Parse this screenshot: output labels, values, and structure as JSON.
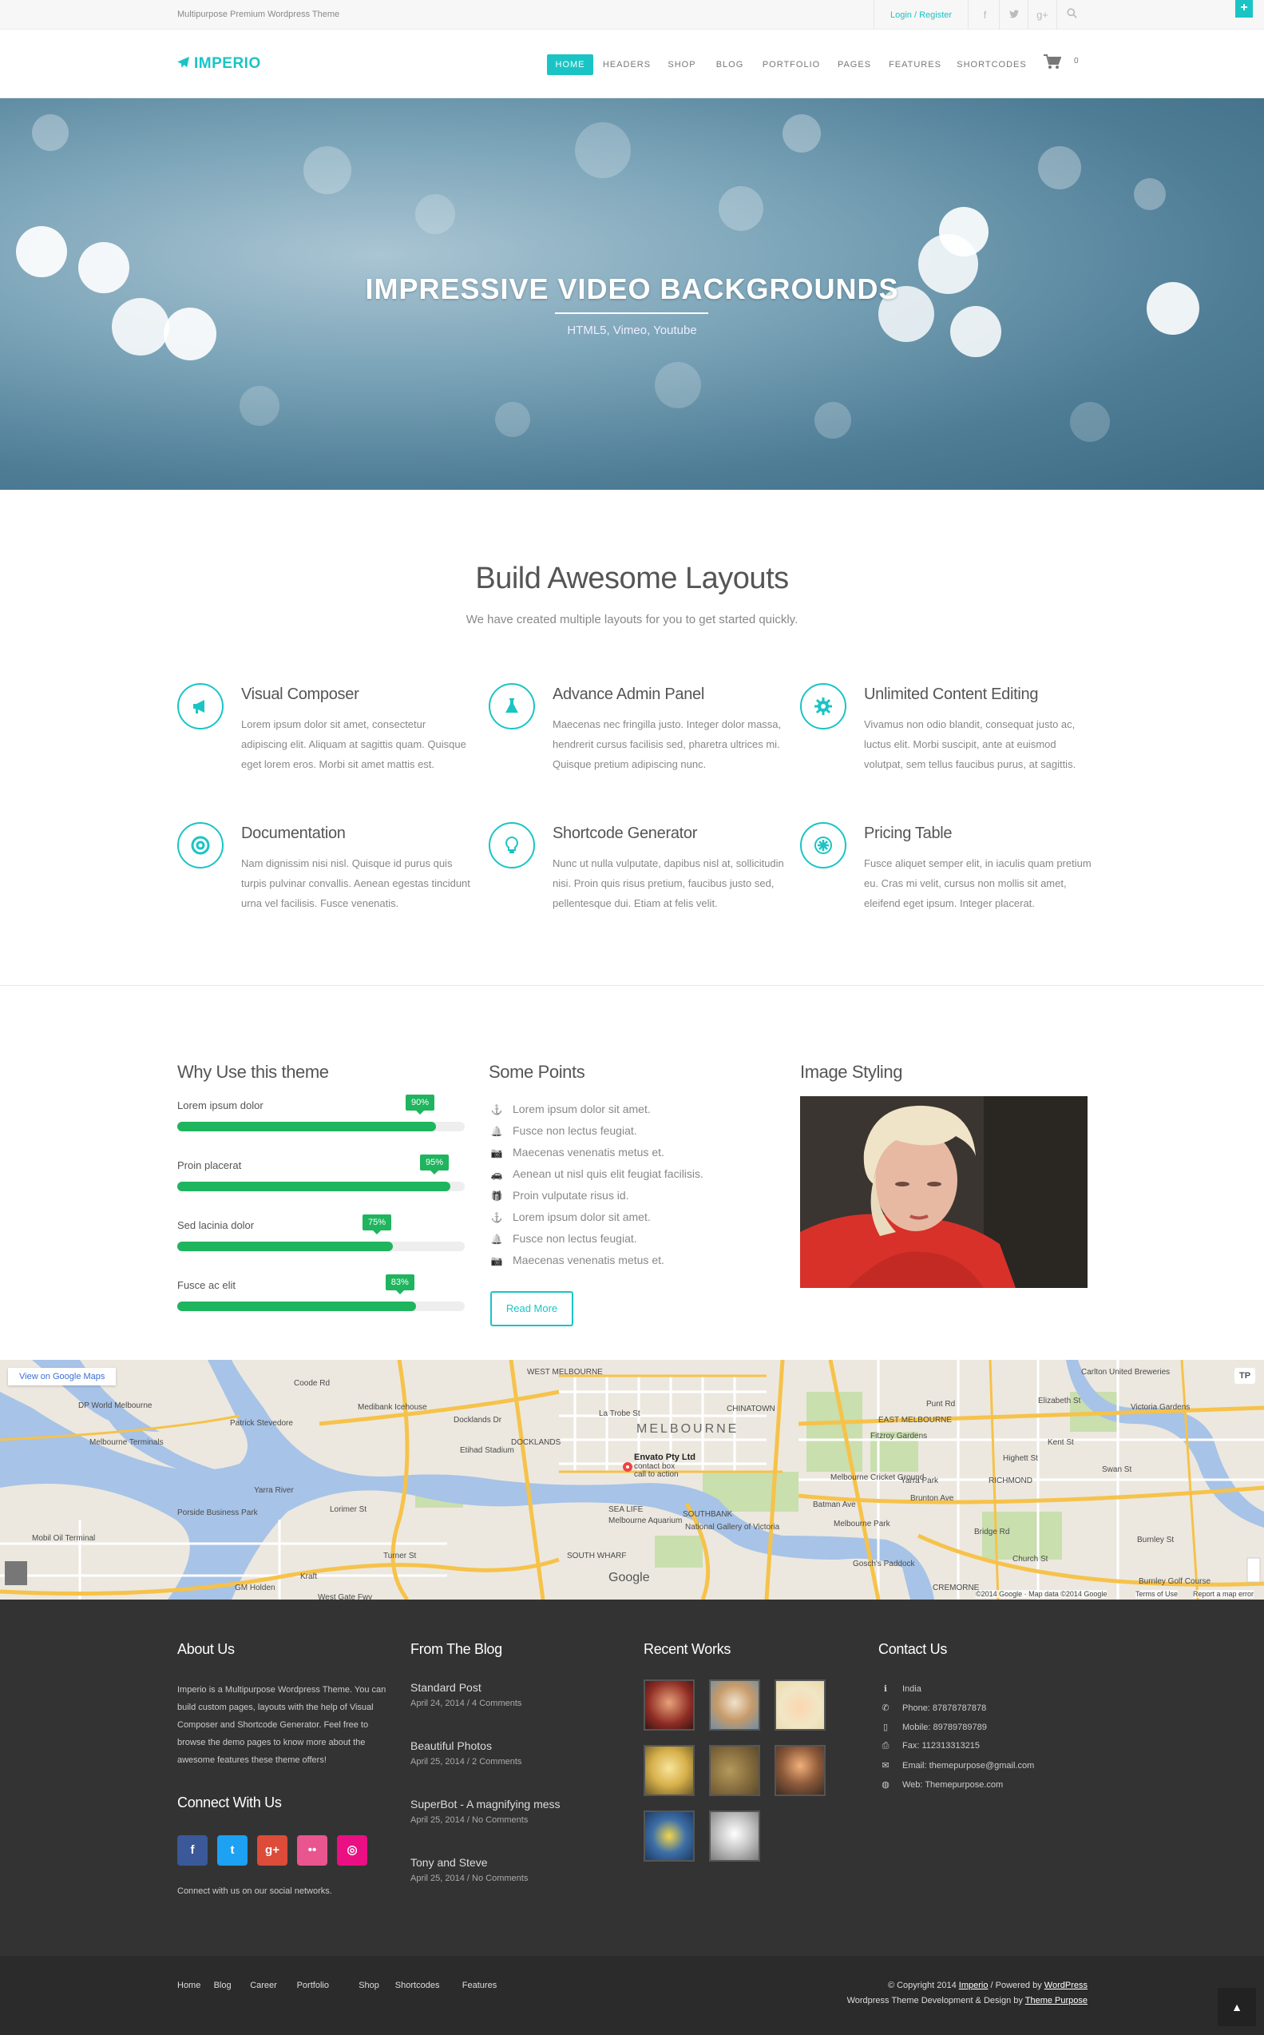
{
  "topbar": {
    "tagline": "Multipurpose Premium Wordpress Theme",
    "login_label": "Login / Register",
    "social_icons": [
      "facebook-icon",
      "twitter-icon",
      "googleplus-icon",
      "search-icon"
    ],
    "plus_label": "+"
  },
  "header": {
    "logo": "IMPERIO",
    "nav": [
      "HOME",
      "HEADERS",
      "SHOP",
      "BLOG",
      "PORTFOLIO",
      "PAGES",
      "FEATURES",
      "SHORTCODES"
    ],
    "active_nav": "HOME",
    "cart_count": "0"
  },
  "hero": {
    "title": "IMPRESSIVE VIDEO BACKGROUNDS",
    "subtitle": "HTML5, Vimeo, Youtube"
  },
  "features": {
    "title": "Build Awesome Layouts",
    "subtitle": "We have created multiple layouts for you to get started quickly.",
    "items": [
      {
        "title": "Visual Composer",
        "icon": "megaphone-icon",
        "text": "Lorem ipsum dolor sit amet, consectetur adipiscing elit. Aliquam at sagittis quam. Quisque eget lorem eros. Morbi sit amet mattis est."
      },
      {
        "title": "Advance Admin Panel",
        "icon": "flask-icon",
        "text": "Maecenas nec fringilla justo. Integer dolor massa, hendrerit cursus facilisis sed, pharetra ultrices mi. Quisque pretium adipiscing nunc."
      },
      {
        "title": "Unlimited Content Editing",
        "icon": "gear-icon",
        "text": "Vivamus non odio blandit, consequat justo ac, luctus elit. Morbi suscipit, ante at euismod volutpat, sem tellus faucibus purus, at sagittis."
      },
      {
        "title": "Documentation",
        "icon": "lifebuoy-icon",
        "text": "Nam dignissim nisi nisl. Quisque id purus quis turpis pulvinar convallis. Aenean egestas tincidunt urna vel facilisis. Fusce venenatis."
      },
      {
        "title": "Shortcode Generator",
        "icon": "lightbulb-icon",
        "text": "Nunc ut nulla vulputate, dapibus nisl at, sollicitudin nisi. Proin quis risus pretium, faucibus justo sed, pellentesque dui. Etiam at felis velit."
      },
      {
        "title": "Pricing Table",
        "icon": "asterisk-icon",
        "text": "Fusce aliquet semper elit, in iaculis quam pretium eu. Cras mi velit, cursus non mollis sit amet, eleifend eget ipsum. Integer placerat."
      }
    ]
  },
  "why": {
    "title": "Why Use this theme",
    "skills": [
      {
        "label": "Lorem ipsum dolor",
        "value": 90,
        "badge": "90%"
      },
      {
        "label": "Proin placerat",
        "value": 95,
        "badge": "95%"
      },
      {
        "label": "Sed lacinia dolor",
        "value": 75,
        "badge": "75%"
      },
      {
        "label": "Fusce ac elit",
        "value": 83,
        "badge": "83%"
      }
    ]
  },
  "points": {
    "title": "Some Points",
    "items": [
      {
        "icon": "anchor-icon",
        "glyph": "⚓",
        "text": "Lorem ipsum dolor sit amet."
      },
      {
        "icon": "bell-icon",
        "glyph": "🔔",
        "text": "Fusce non lectus feugiat."
      },
      {
        "icon": "camera-icon",
        "glyph": "📷",
        "text": "Maecenas venenatis metus et."
      },
      {
        "icon": "car-icon",
        "glyph": "🚗",
        "text": "Aenean ut nisl quis elit feugiat facilisis."
      },
      {
        "icon": "gift-icon",
        "glyph": "🎁",
        "text": "Proin vulputate risus id."
      },
      {
        "icon": "anchor-icon",
        "glyph": "⚓",
        "text": "Lorem ipsum dolor sit amet."
      },
      {
        "icon": "bell-icon",
        "glyph": "🔔",
        "text": "Fusce non lectus feugiat."
      },
      {
        "icon": "camera-icon",
        "glyph": "📷",
        "text": "Maecenas venenatis metus et."
      }
    ],
    "button": "Read More"
  },
  "image_styling": {
    "title": "Image Styling"
  },
  "map": {
    "link": "View on Google Maps",
    "labels": [
      "Envato Pty Ltd",
      "contact box",
      "call to action",
      "MELBOURNE",
      "DOCKLANDS",
      "SOUTHBANK",
      "SOUTH WHARF",
      "SEA LIFE",
      "Melbourne Aquarium",
      "National Gallery of Victoria",
      "Melbourne Cricket Ground",
      "Yarra Park",
      "Fitzroy Gardens",
      "EAST MELBOURNE",
      "RICHMOND",
      "CREMORNE",
      "Victoria Gardens",
      "Carlton United Breweries",
      "Coode Rd",
      "DP World Melbourne",
      "Patrick Stevedore",
      "Medibank Icehouse",
      "Melbourne Terminals",
      "Etihad Stadium",
      "Docklands Dr",
      "Yarra River",
      "Lorimer St",
      "Porside Business Park",
      "Mobil Oil Terminal",
      "Turner St",
      "Kraft",
      "GM Holden",
      "West Gate Fwy",
      "WEST MELBOURNE",
      "CHINATOWN",
      "La Trobe St",
      "Melbourne Park",
      "Gosch's Paddock",
      "Burnley Golf Course",
      "Highett St",
      "Kent St",
      "Elizabeth St",
      "Bridge Rd",
      "Swan St",
      "Batman Ave",
      "Brunton Ave",
      "Church St",
      "Burnley St",
      "Punt Rd",
      "Google"
    ],
    "credit": "©2014 Google · Map data ©2014 Google",
    "terms": "Terms of Use",
    "report": "Report a map error"
  },
  "footer": {
    "about_title": "About Us",
    "about_text": "Imperio is a Multipurpose Wordpress Theme. You can build custom pages, layouts with the help of Visual Composer and Shortcode Generator. Feel free to browse the demo pages to know more about the awesome features these theme offers!",
    "connect_title": "Connect With Us",
    "social": [
      {
        "icon": "facebook-icon",
        "glyph": "f",
        "color": "#3b5998"
      },
      {
        "icon": "twitter-icon",
        "glyph": "t",
        "color": "#1da1f2"
      },
      {
        "icon": "googleplus-icon",
        "glyph": "g+",
        "color": "#dd4b39"
      },
      {
        "icon": "flickr-icon",
        "glyph": "••",
        "color": "#e9558f"
      },
      {
        "icon": "dribbble-icon",
        "glyph": "◎",
        "color": "#ea0f83"
      }
    ],
    "connect_text": "Connect with us on our social networks.",
    "blog_title": "From The Blog",
    "posts": [
      {
        "title": "Standard Post",
        "meta": "April 24, 2014 / 4 Comments"
      },
      {
        "title": "Beautiful Photos",
        "meta": "April 25, 2014 / 2 Comments"
      },
      {
        "title": "SuperBot - A magnifying mess",
        "meta": "April 25, 2014 / No Comments"
      },
      {
        "title": "Tony and Steve",
        "meta": "April 25, 2014 / No Comments"
      }
    ],
    "works_title": "Recent Works",
    "contact_title": "Contact Us",
    "contact": [
      {
        "icon": "info-icon",
        "glyph": "ℹ",
        "text": "India"
      },
      {
        "icon": "phone-icon",
        "glyph": "✆",
        "text": "Phone: 87878787878"
      },
      {
        "icon": "mobile-icon",
        "glyph": "▯",
        "text": "Mobile: 89789789789"
      },
      {
        "icon": "print-icon",
        "glyph": "⎙",
        "text": "Fax: 112313313215"
      },
      {
        "icon": "mail-icon",
        "glyph": "✉",
        "text": "Email: themepurpose@gmail.com"
      },
      {
        "icon": "globe-icon",
        "glyph": "◍",
        "text": "Web: Themepurpose.com"
      }
    ]
  },
  "bottom": {
    "links": [
      "Home",
      "Blog",
      "Career",
      "Portfolio",
      "Shop",
      "Shortcodes",
      "Features"
    ],
    "copy1_pre": "© Copyright 2014 ",
    "copy1_link1": "Imperio",
    "copy1_mid": " / Powered by ",
    "copy1_link2": "WordPress",
    "copy2_pre": "Wordpress Theme Development & Design by ",
    "copy2_link": "Theme Purpose",
    "totop": "▲"
  },
  "colors": {
    "accent": "#1bc4c4",
    "progress": "#1fb45e",
    "footer": "#333333",
    "footer_bottom": "#2b2b2b"
  }
}
